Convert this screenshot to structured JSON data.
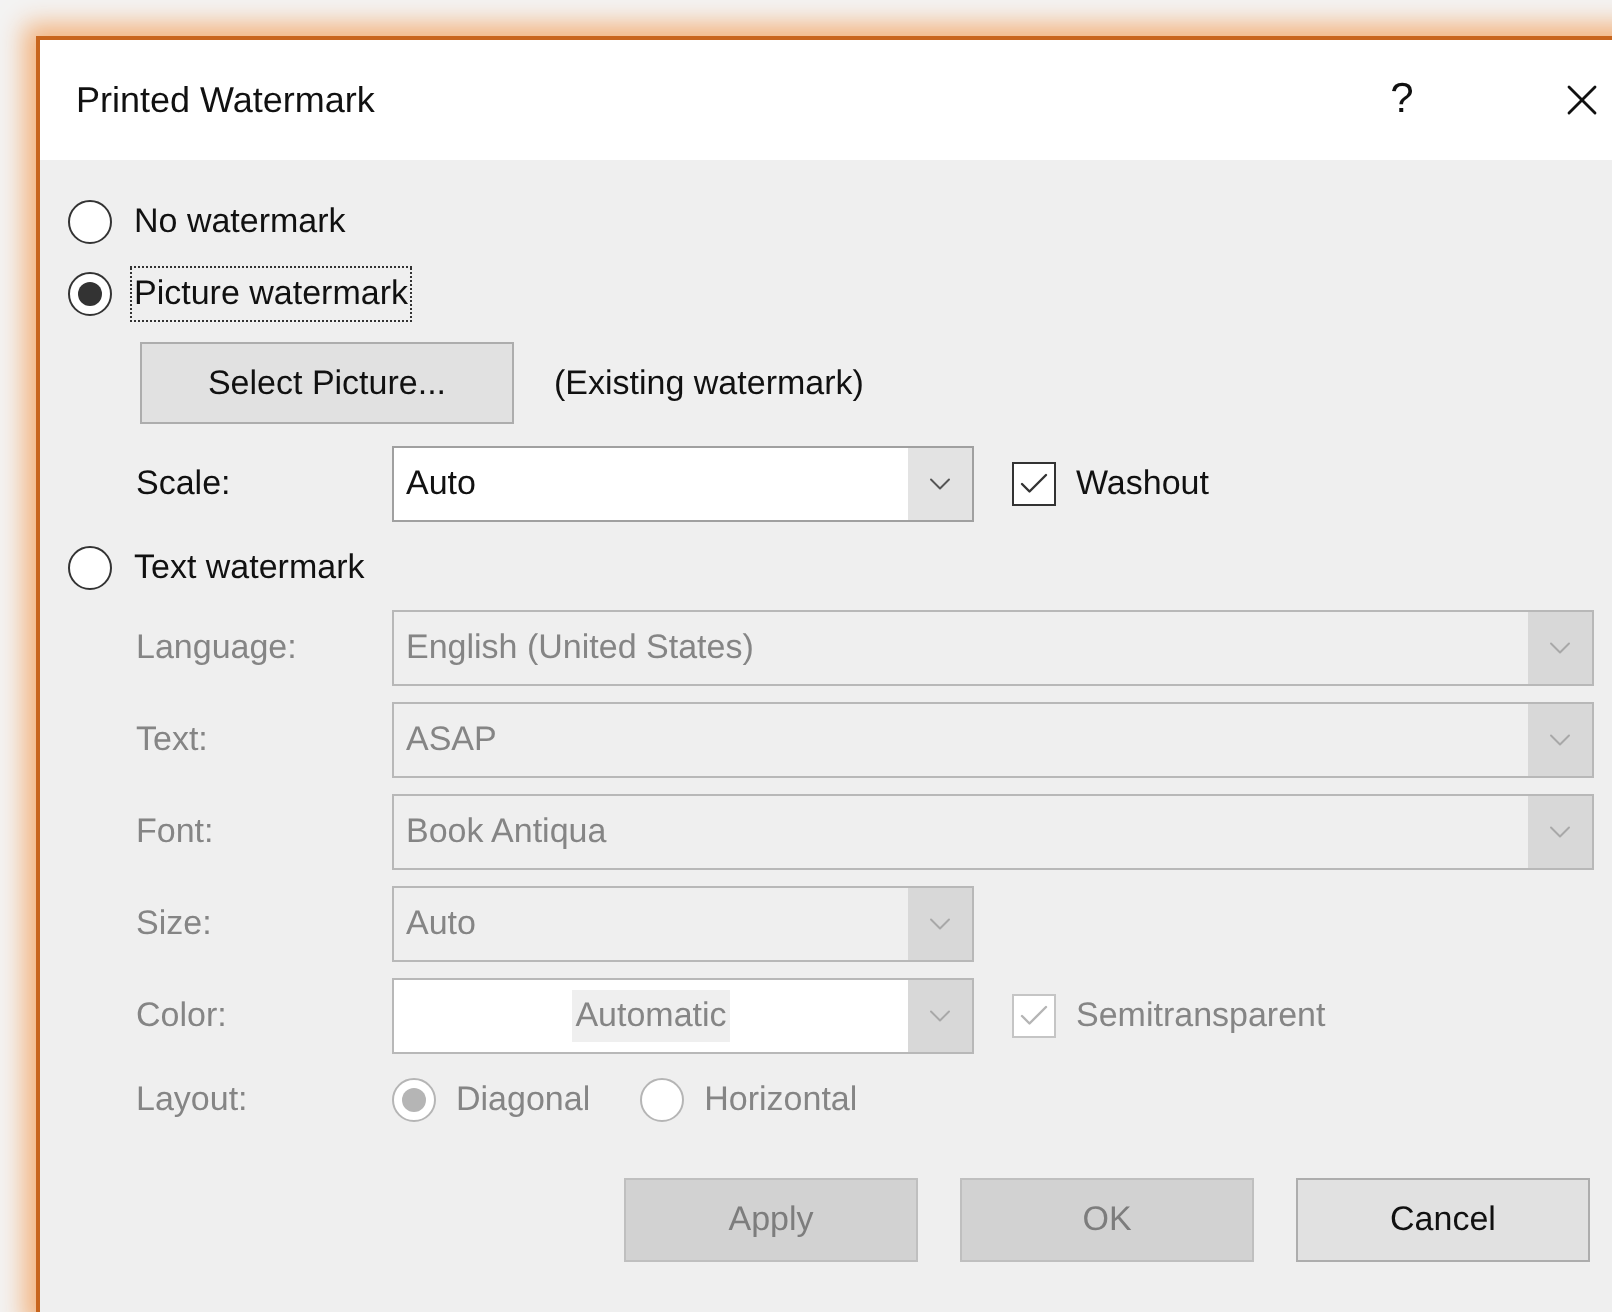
{
  "dialog": {
    "title": "Printed Watermark",
    "help": "?"
  },
  "no_watermark": {
    "label": "No watermark",
    "selected": false,
    "focused": false
  },
  "picture_watermark": {
    "label": "Picture watermark",
    "selected": true,
    "focused": true
  },
  "select_picture_button": {
    "label": "Select Picture...",
    "disabled": false
  },
  "existing_note": "(Existing watermark)",
  "scale": {
    "label": "Scale:",
    "value": "Auto",
    "disabled": false
  },
  "washout": {
    "label": "Washout",
    "checked": true,
    "disabled": false
  },
  "text_watermark": {
    "label": "Text watermark",
    "selected": false,
    "focused": false
  },
  "text_fields": [
    {
      "label": "Language:",
      "value": "English (United States)",
      "kind": "wide",
      "disabled": true
    },
    {
      "label": "Text:",
      "value": "ASAP",
      "kind": "wide",
      "disabled": true
    },
    {
      "label": "Font:",
      "value": "Book Antiqua",
      "kind": "wide",
      "disabled": true
    },
    {
      "label": "Size:",
      "value": "Auto",
      "kind": "narrow",
      "disabled": true
    }
  ],
  "color": {
    "label": "Color:",
    "value": "Automatic",
    "disabled": true
  },
  "semitransparent": {
    "label": "Semitransparent",
    "checked": true,
    "disabled": true
  },
  "layout": {
    "label": "Layout:",
    "options": [
      {
        "label": "Diagonal",
        "selected": true,
        "disabled": true
      },
      {
        "label": "Horizontal",
        "selected": false,
        "disabled": true
      }
    ]
  },
  "buttons": [
    {
      "label": "Apply",
      "disabled": true
    },
    {
      "label": "OK",
      "disabled": true
    },
    {
      "label": "Cancel",
      "disabled": false
    }
  ]
}
